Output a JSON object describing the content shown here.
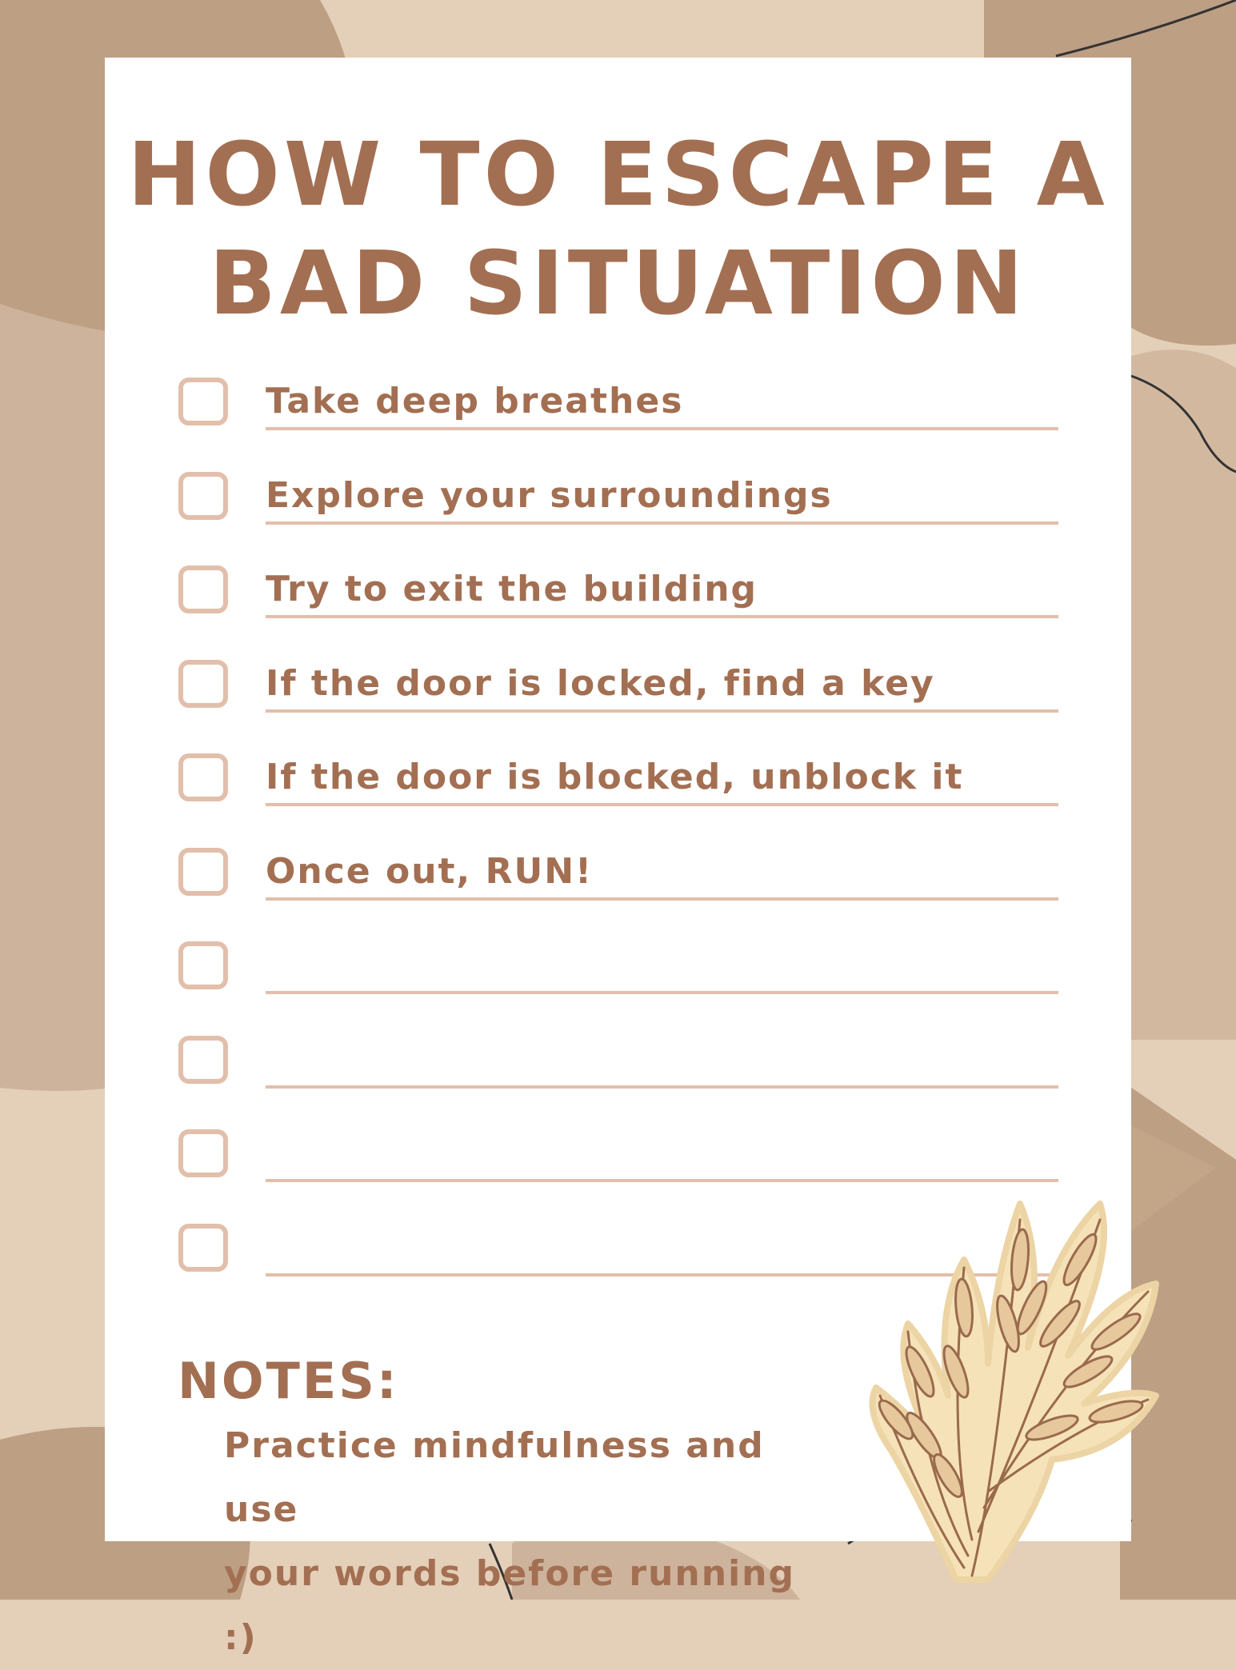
{
  "title": {
    "line1": "HOW TO ESCAPE A",
    "line2": "BAD SITUATION"
  },
  "checklist": [
    {
      "text": "Take deep breathes",
      "checked": false
    },
    {
      "text": "Explore your surroundings",
      "checked": false
    },
    {
      "text": "Try to exit the building",
      "checked": false
    },
    {
      "text": "If the door is locked, find a key",
      "checked": false
    },
    {
      "text": "If the door is blocked, unblock it",
      "checked": false
    },
    {
      "text": "Once out, RUN!",
      "checked": false
    },
    {
      "text": "",
      "checked": false
    },
    {
      "text": "",
      "checked": false
    },
    {
      "text": "",
      "checked": false
    },
    {
      "text": "",
      "checked": false
    }
  ],
  "notes": {
    "heading": "NOTES:",
    "line1": "Practice mindfulness and use",
    "line2": "your words before running :)"
  },
  "colors": {
    "text": "#a36f52",
    "checkbox": "#e2bfab",
    "paper": "#ffffff",
    "background_light": "#e4cfb8",
    "background_dark": "#bd9f84",
    "leaf_fill": "#f6e2b8",
    "leaf_stroke": "#9a6a4c"
  },
  "decorations": {
    "leaf_icon": "wheat-leaf-icon"
  }
}
